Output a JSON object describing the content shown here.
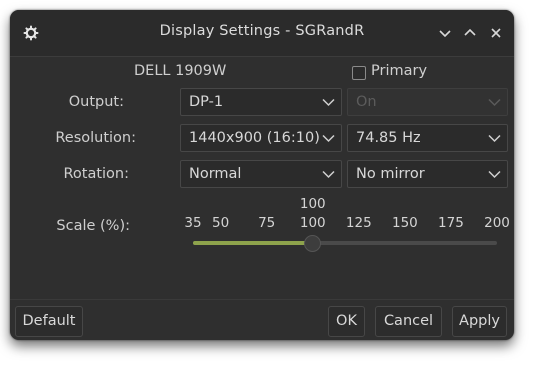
{
  "window": {
    "title": "Display Settings - SGRandR",
    "icons": {
      "app": "gear-icon",
      "minimize": "chevron-down-icon",
      "maximize": "chevron-up-icon",
      "close": "close-icon"
    }
  },
  "monitor": {
    "name": "DELL 1909W",
    "primary_label": "Primary",
    "primary_checked": false
  },
  "output": {
    "label": "Output:",
    "value": "DP-1",
    "state_value": "On",
    "state_disabled": true
  },
  "resolution": {
    "label": "Resolution:",
    "value": "1440x900 (16:10)",
    "refresh": "74.85 Hz"
  },
  "rotation": {
    "label": "Rotation:",
    "value": "Normal",
    "mirror": "No mirror"
  },
  "scale": {
    "label": "Scale (%):",
    "ticks": [
      "35",
      "50",
      "75",
      "100",
      "125",
      "150",
      "175",
      "200"
    ],
    "current_label": "100",
    "min": 35,
    "max": 200,
    "value": 100
  },
  "buttons": {
    "default": "Default",
    "ok": "OK",
    "cancel": "Cancel",
    "apply": "Apply"
  },
  "colors": {
    "accent": "#8ea34c",
    "window_bg": "#2f2f2f"
  }
}
